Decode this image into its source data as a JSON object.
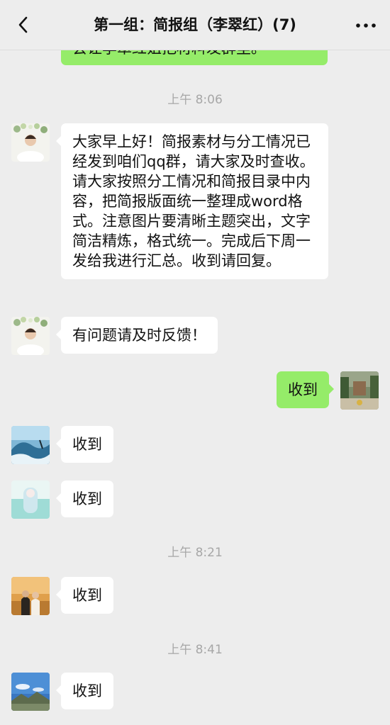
{
  "header": {
    "title": "第一组：简报组（李翠红）(7)",
    "back_icon": "chevron-left-icon",
    "more_icon": "ellipsis-icon"
  },
  "colors": {
    "background": "#ededed",
    "bubble_in": "#ffffff",
    "bubble_out": "#95ec69",
    "timestamp": "#a7a7a7"
  },
  "messages": {
    "partial_top": "会让李翠红姐把材料发群里。",
    "time_1": "上午 8:06",
    "long_notice": "大家早上好！简报素材与分工情况已经发到咱们qq群，请大家及时查收。请大家按照分工情况和简报目录中内容，把简报版面统一整理成word格式。注意图片要清晰主题突出，文字简洁精炼，格式统一。完成后下周一发给我进行汇总。收到请回复。",
    "feedback": "有问题请及时反馈！",
    "my_reply": "收到",
    "reply_1": "收到",
    "reply_2": "收到",
    "time_2": "上午 8:21",
    "reply_3": "收到",
    "time_3": "上午 8:41",
    "reply_4": "收到"
  }
}
